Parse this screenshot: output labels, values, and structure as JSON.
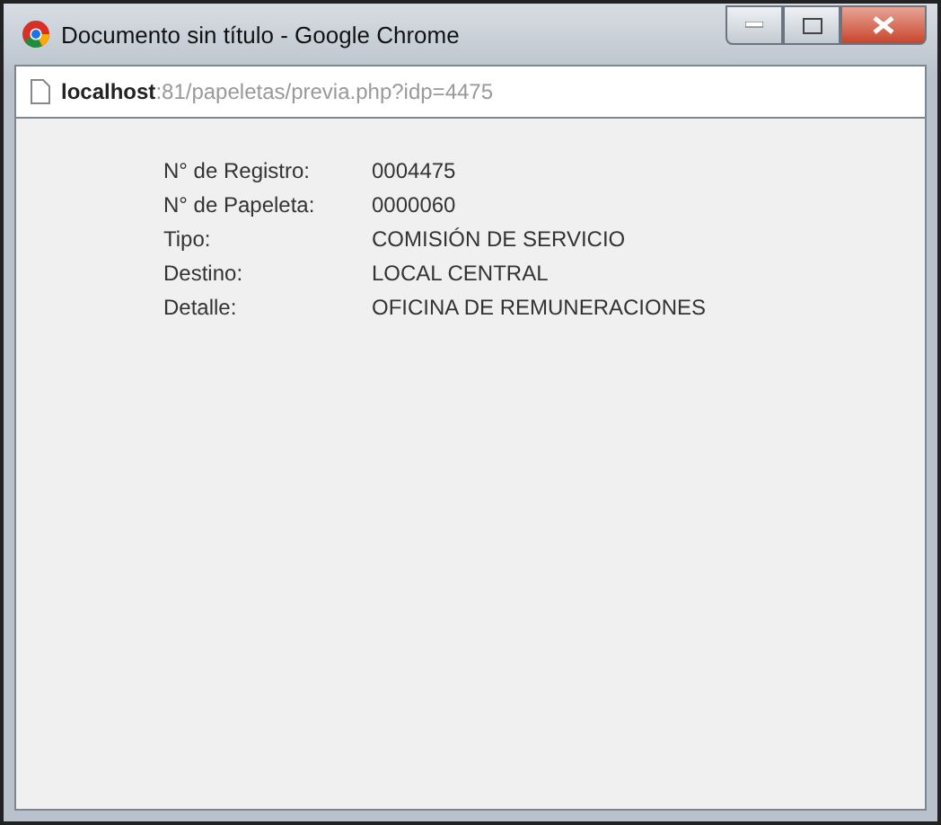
{
  "window": {
    "title": "Documento sin título - Google Chrome"
  },
  "address_bar": {
    "host": "localhost",
    "path": ":81/papeletas/previa.php?idp=4475"
  },
  "fields": [
    {
      "label": "N° de Registro:",
      "value": "0004475"
    },
    {
      "label": "N° de Papeleta:",
      "value": "0000060"
    },
    {
      "label": "Tipo:",
      "value": "COMISIÓN DE SERVICIO"
    },
    {
      "label": "Destino:",
      "value": "LOCAL CENTRAL"
    },
    {
      "label": "Detalle:",
      "value": "OFICINA DE REMUNERACIONES"
    }
  ]
}
